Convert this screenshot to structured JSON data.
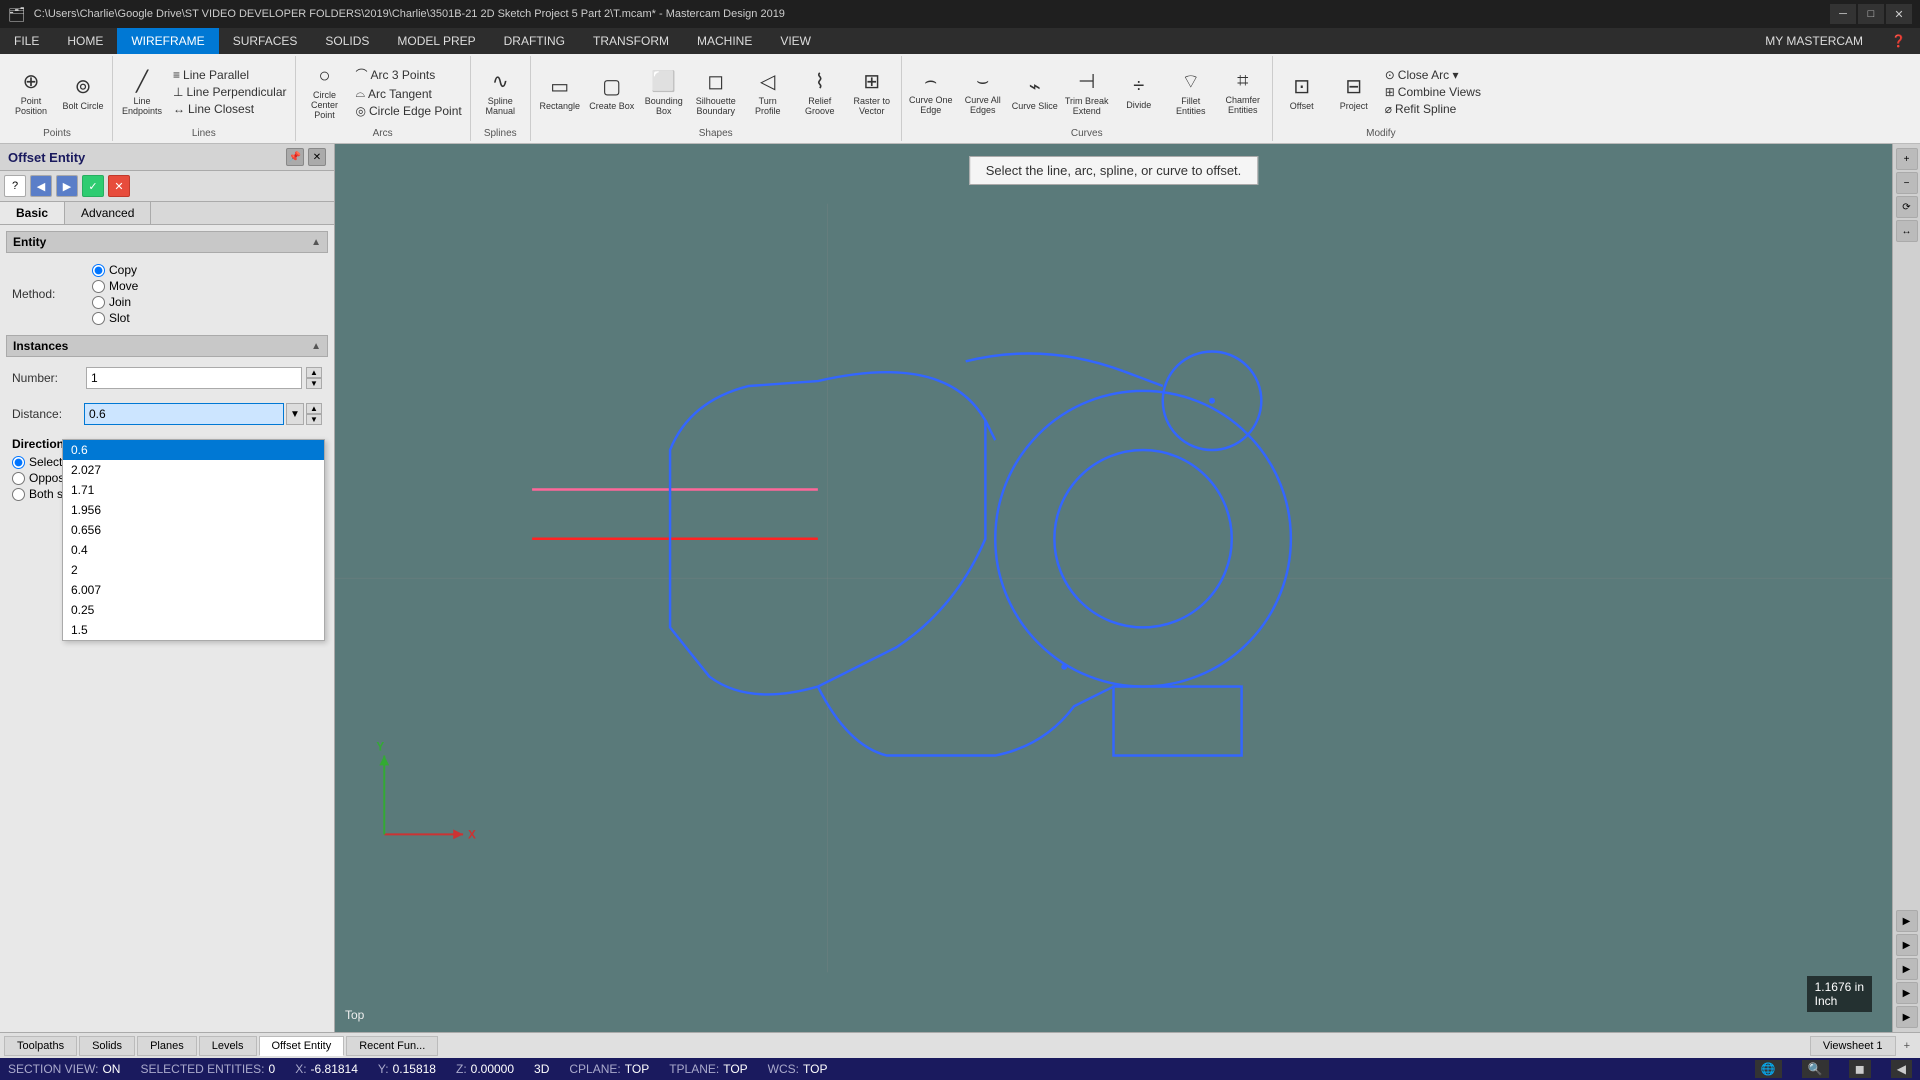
{
  "window": {
    "title": "C:\\Users\\Charlie\\Google Drive\\ST VIDEO DEVELOPER FOLDERS\\2019\\Charlie\\3501B-21 2D Sketch Project 5 Part 2\\T.mcam* - Mastercam Design 2019",
    "brand": "MY MASTERCAM"
  },
  "menubar": {
    "items": [
      "FILE",
      "HOME",
      "WIREFRAME",
      "SURFACES",
      "SOLIDS",
      "MODEL PREP",
      "DRAFTING",
      "TRANSFORM",
      "MACHINE",
      "VIEW"
    ],
    "active": "WIREFRAME"
  },
  "toolbar": {
    "sections": [
      {
        "label": "Points",
        "buttons": [
          {
            "label": "Point Position",
            "icon": "⊕"
          },
          {
            "label": "Bolt Circle",
            "icon": "⊚"
          }
        ]
      },
      {
        "label": "Lines",
        "buttons": [
          {
            "label": "Line Endpoints",
            "icon": "╱"
          },
          {
            "label": "Line Parallel",
            "icon": "≡"
          },
          {
            "label": "Line Perpendicular",
            "icon": "⊥"
          },
          {
            "label": "Line Closest",
            "icon": "↔"
          }
        ]
      },
      {
        "label": "Arcs",
        "buttons": [
          {
            "label": "Arc 3 Points",
            "icon": "⌒"
          },
          {
            "label": "Arc Tangent",
            "icon": "⌓"
          },
          {
            "label": "Circle Center Point",
            "icon": "○"
          },
          {
            "label": "Circle Edge Point",
            "icon": "◎"
          }
        ]
      },
      {
        "label": "Splines",
        "buttons": [
          {
            "label": "Spline Manual",
            "icon": "∿"
          }
        ]
      },
      {
        "label": "Shapes",
        "buttons": [
          {
            "label": "Rectangle",
            "icon": "▭"
          },
          {
            "label": "Create Box",
            "icon": "▢"
          },
          {
            "label": "Bounding Box",
            "icon": "⬜"
          },
          {
            "label": "Silhouette Boundary",
            "icon": "◻"
          },
          {
            "label": "Turn Profile",
            "icon": "◁"
          },
          {
            "label": "Relief Groove",
            "icon": "⌇"
          },
          {
            "label": "Raster to Vector",
            "icon": "⊞"
          }
        ]
      },
      {
        "label": "Curves",
        "buttons": [
          {
            "label": "Curve One Edge",
            "icon": "⌢"
          },
          {
            "label": "Curve All Edges",
            "icon": "⌣"
          },
          {
            "label": "Curve Slice",
            "icon": "⌁"
          },
          {
            "label": "Trim Break Extend",
            "icon": "⊣"
          },
          {
            "label": "Divide",
            "icon": "÷"
          },
          {
            "label": "Fillet Entities",
            "icon": "⌔"
          },
          {
            "label": "Chamfer Entities",
            "icon": "⌗"
          }
        ]
      },
      {
        "label": "Modify",
        "buttons": [
          {
            "label": "Offset",
            "icon": "⊡"
          },
          {
            "label": "Project",
            "icon": "⊟"
          },
          {
            "label": "Close Arc",
            "icon": "⊙"
          },
          {
            "label": "Combine Views",
            "icon": "⊞"
          },
          {
            "label": "Refit Spline",
            "icon": "⌀"
          }
        ]
      }
    ]
  },
  "panel": {
    "title": "Offset Entity",
    "tabs": [
      "Basic",
      "Advanced"
    ],
    "active_tab": "Basic",
    "help_icon": "?",
    "prompt": "Select the line, arc, spline, or curve to offset.",
    "sections": {
      "entity": {
        "label": "Entity",
        "method": {
          "label": "Method:",
          "options": [
            "Copy",
            "Move",
            "Join",
            "Slot"
          ],
          "selected": "Copy"
        }
      },
      "instances": {
        "label": "Instances",
        "number_label": "Number:",
        "number_value": "1"
      },
      "distance": {
        "label": "Distance:",
        "value": "0.6",
        "history": [
          "0.6",
          "2.027",
          "1.71",
          "1.956",
          "0.656",
          "0.4",
          "2",
          "6.007",
          "0.25",
          "1.5"
        ]
      },
      "direction": {
        "label": "Direction",
        "options": [
          "Selected side",
          "Opposite side",
          "Both sides"
        ],
        "selected": "Selected side"
      }
    }
  },
  "canvas": {
    "view_label": "Top",
    "scale_text": "1.1676 in",
    "scale_unit": "Inch",
    "axis": {
      "x_label": "X",
      "y_label": "Y"
    }
  },
  "status_bar": {
    "section_view": {
      "label": "SECTION VIEW:",
      "value": "ON"
    },
    "selected": {
      "label": "SELECTED ENTITIES:",
      "value": "0"
    },
    "x": {
      "label": "X:",
      "value": "-6.81814"
    },
    "y": {
      "label": "Y:",
      "value": "0.15818"
    },
    "z": {
      "label": "Z:",
      "value": "0.00000"
    },
    "mode": "3D",
    "cplane": {
      "label": "CPLANE:",
      "value": "TOP"
    },
    "tplane": {
      "label": "TPLANE:",
      "value": "TOP"
    },
    "wcs": {
      "label": "WCS:",
      "value": "TOP"
    }
  },
  "bottom_tabs": [
    "Toolpaths",
    "Solids",
    "Planes",
    "Levels",
    "Offset Entity",
    "Recent Fun..."
  ],
  "bottom_tab_active": "Offset Entity",
  "viewsheet": {
    "label": "Viewsheet 1",
    "add_btn": "+"
  }
}
